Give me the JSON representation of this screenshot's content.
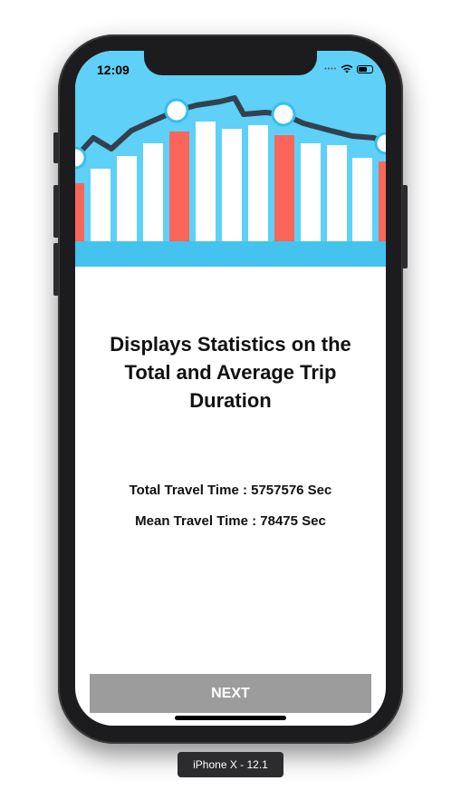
{
  "status_bar": {
    "time": "12:09",
    "signal_icon": "signal-dots-icon",
    "wifi_icon": "wifi-icon",
    "battery_icon": "battery-icon"
  },
  "banner": {
    "icon": "bar-chart-illustration",
    "colors": {
      "sky": "#5fd0f7",
      "bar_white": "#ffffff",
      "bar_red": "#fb665b",
      "line": "#33414f"
    }
  },
  "main": {
    "title": "Displays Statistics on the Total and Average Trip Duration",
    "total_travel_time": "Total Travel Time : 5757576 Sec",
    "mean_travel_time": "Mean Travel Time : 78475 Sec"
  },
  "footer": {
    "next_label": "NEXT",
    "button_color": "#9c9c9c"
  },
  "device": {
    "label": "iPhone X - 12.1"
  }
}
